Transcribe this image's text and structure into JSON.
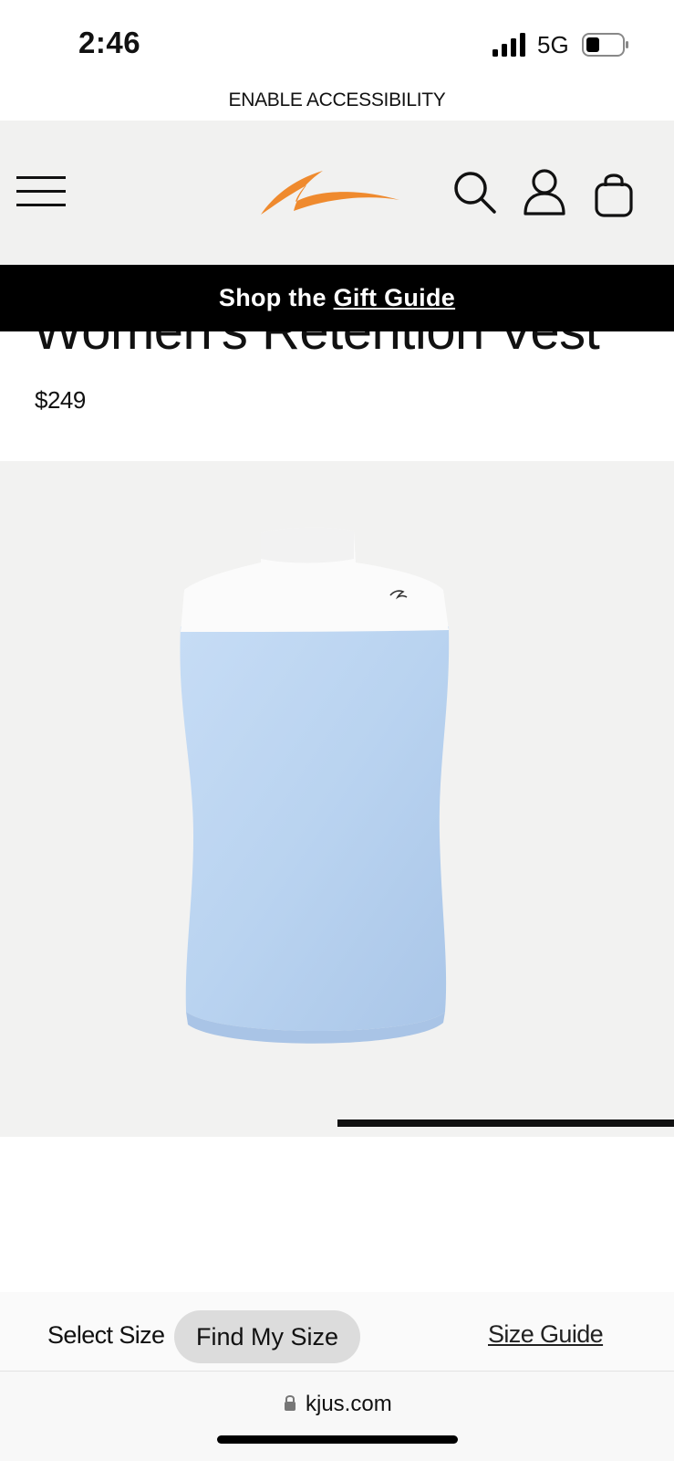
{
  "status_bar": {
    "time": "2:46",
    "network": "5G",
    "signal_icon": "signal-bars-icon",
    "battery_icon": "battery-icon",
    "battery_level": 0.35
  },
  "accessibility": {
    "label": "ENABLE ACCESSIBILITY"
  },
  "header": {
    "menu_icon": "hamburger-menu-icon",
    "logo_icon": "kjus-logo",
    "search_icon": "search-icon",
    "account_icon": "user-icon",
    "cart_icon": "shopping-bag-icon",
    "background": "#f1f1f0",
    "logo_color": "#ef8a2e"
  },
  "promo": {
    "prefix": "Shop the ",
    "link": "Gift Guide",
    "background": "#000000"
  },
  "product": {
    "title": "Women's Retention Vest",
    "price": "$249",
    "image": "light blue and white vest product photo",
    "vest_colors": {
      "body": "#bcd6f2",
      "yoke": "#fbfbfb"
    },
    "gallery_progress": 0.5
  },
  "size_bar": {
    "select_label": "Select Size",
    "find_button": "Find My Size",
    "guide_link": "Size Guide"
  },
  "browser": {
    "url": "kjus.com",
    "lock_icon": "lock-icon"
  }
}
